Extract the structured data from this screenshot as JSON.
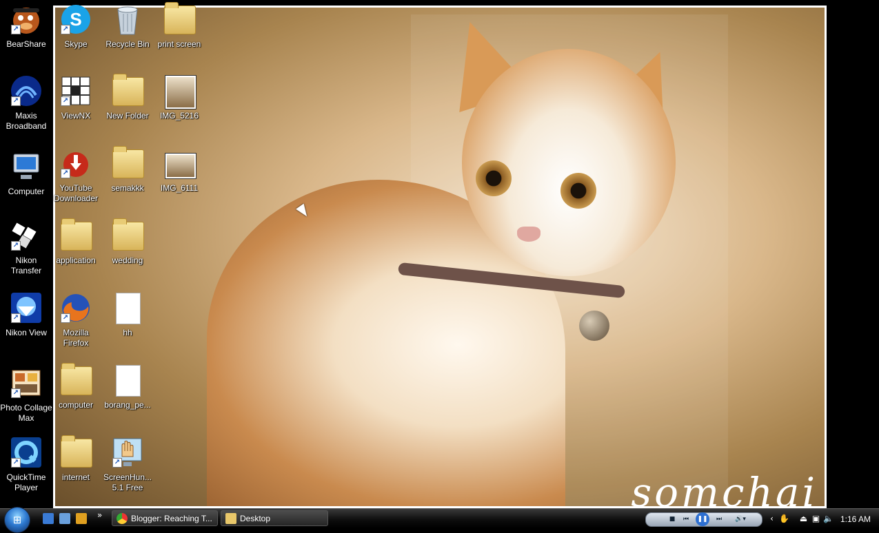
{
  "desktop": {
    "icons": [
      {
        "label": "BearShare",
        "icon": "bearshare-icon",
        "shortcut": true
      },
      {
        "label": "Skype",
        "icon": "skype-icon",
        "shortcut": true
      },
      {
        "label": "Recycle Bin",
        "icon": "recycle-bin-icon",
        "shortcut": false
      },
      {
        "label": "print screen",
        "icon": "folder-icon",
        "shortcut": false
      },
      {
        "label": "Maxis Broadband",
        "icon": "maxis-broadband-icon",
        "shortcut": true
      },
      {
        "label": "ViewNX",
        "icon": "viewnx-icon",
        "shortcut": true
      },
      {
        "label": "New Folder",
        "icon": "folder-icon",
        "shortcut": false
      },
      {
        "label": "IMG_5216",
        "icon": "image-file-icon",
        "shortcut": false
      },
      {
        "label": "Computer",
        "icon": "computer-icon",
        "shortcut": false
      },
      {
        "label": "YouTube Downloader",
        "icon": "youtube-downloader-icon",
        "shortcut": true
      },
      {
        "label": "semakkk",
        "icon": "folder-icon",
        "shortcut": false
      },
      {
        "label": "IMG_6111",
        "icon": "image-file-icon",
        "shortcut": false
      },
      {
        "label": "Nikon Transfer",
        "icon": "nikon-transfer-icon",
        "shortcut": true
      },
      {
        "label": "application",
        "icon": "folder-icon",
        "shortcut": false
      },
      {
        "label": "wedding",
        "icon": "folder-icon",
        "shortcut": false
      },
      {
        "label": "Nikon View",
        "icon": "nikon-view-icon",
        "shortcut": true
      },
      {
        "label": "Mozilla Firefox",
        "icon": "firefox-icon",
        "shortcut": true
      },
      {
        "label": "hh",
        "icon": "text-file-icon",
        "shortcut": false
      },
      {
        "label": "Photo Collage Max",
        "icon": "photo-collage-icon",
        "shortcut": true
      },
      {
        "label": "computer",
        "icon": "folder-icon",
        "shortcut": false
      },
      {
        "label": "borang_pe...",
        "icon": "document-file-icon",
        "shortcut": false
      },
      {
        "label": "QuickTime Player",
        "icon": "quicktime-icon",
        "shortcut": true
      },
      {
        "label": "internet",
        "icon": "folder-icon",
        "shortcut": false
      },
      {
        "label": "ScreenHun... 5.1 Free",
        "icon": "screenhunter-icon",
        "shortcut": true
      }
    ],
    "wallpaper_signature": "somchai"
  },
  "taskbar": {
    "start_label": "Start",
    "quick_launch": [
      "mail-icon",
      "show-desktop-icon",
      "media-player-icon"
    ],
    "overflow_label": "»",
    "buttons": [
      {
        "label": "Blogger: Reaching T...",
        "icon": "chrome-icon"
      },
      {
        "label": "Desktop",
        "icon": "folder-icon"
      }
    ],
    "media_controls": [
      "stop-icon",
      "previous-icon",
      "pause-icon",
      "next-icon",
      "volume-icon"
    ],
    "tray_icons": [
      "chevron-left-icon",
      "screenhunter-tray-icon",
      "safely-remove-icon",
      "network-icon",
      "speaker-icon"
    ],
    "clock": "1:16 AM"
  },
  "colors": {
    "taskbar": "#0e0e0e",
    "label_text": "#ffffff",
    "start_orb": "#2e7ad1"
  }
}
